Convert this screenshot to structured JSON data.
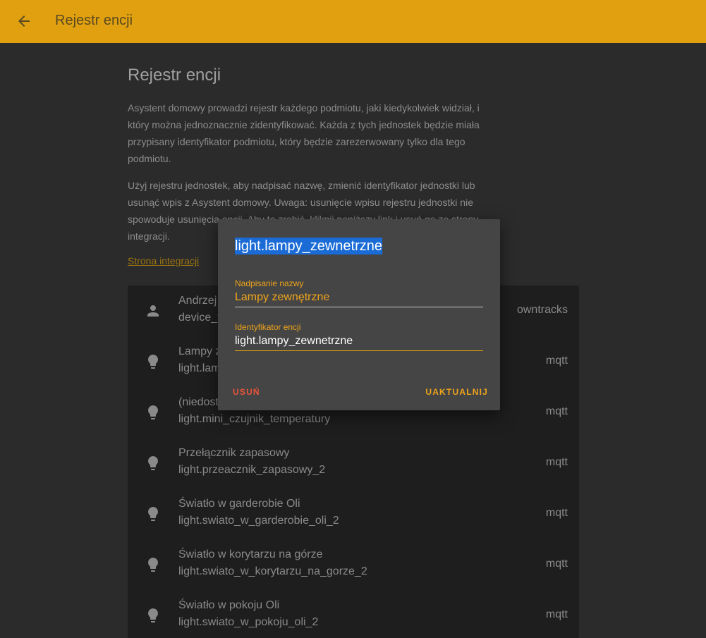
{
  "toolbar": {
    "title": "Rejestr encji",
    "back_icon": "arrow-left-icon",
    "background": "#e0a00f"
  },
  "page": {
    "heading": "Rejestr encji",
    "paragraph1": "Asystent domowy prowadzi rejestr każdego podmiotu, jaki kiedykolwiek widział, i który można jednoznacznie zidentyfikować. Każda z tych jednostek będzie miała przypisany identyfikator podmiotu, który będzie zarezerwowany tylko dla tego podmiotu.",
    "paragraph2": "Użyj rejestru jednostek, aby nadpisać nazwę, zmienić identyfikator jednostki lub usunąć wpis z Asystent domowy. Uwaga: usunięcie wpisu rejestru jednostki nie spowoduje usunięcia encji. Aby to zrobić, kliknij poniższy link i usuń go ze strony integracji.",
    "integrations_link": "Strona integracji"
  },
  "entities": [
    {
      "name": "Andrzej",
      "entity_id": "device_t",
      "platform": "owntracks",
      "icon": "account-icon"
    },
    {
      "name": "Lampy z",
      "entity_id": "light.lam",
      "platform": "mqtt",
      "icon": "lightbulb-icon"
    },
    {
      "name": "(niedost",
      "entity_id": "light.mini_czujnik_temperatury",
      "platform": "mqtt",
      "icon": "lightbulb-icon"
    },
    {
      "name": "Przełącznik zapasowy",
      "entity_id": "light.przeacznik_zapasowy_2",
      "platform": "mqtt",
      "icon": "lightbulb-icon"
    },
    {
      "name": "Światło w garderobie Oli",
      "entity_id": "light.swiato_w_garderobie_oli_2",
      "platform": "mqtt",
      "icon": "lightbulb-icon"
    },
    {
      "name": "Światło w korytarzu na górze",
      "entity_id": "light.swiato_w_korytarzu_na_gorze_2",
      "platform": "mqtt",
      "icon": "lightbulb-icon"
    },
    {
      "name": "Światło w pokoju Oli",
      "entity_id": "light.swiato_w_pokoju_oli_2",
      "platform": "mqtt",
      "icon": "lightbulb-icon"
    }
  ],
  "dialog": {
    "title": "light.lampy_zewnetrzne",
    "name_label": "Nadpisanie nazwy",
    "name_value": "Lampy zewnętrzne",
    "id_label": "Identyfikator encji",
    "id_value": "light.lampy_zewnetrzne",
    "delete_label": "USUŃ",
    "update_label": "UAKTUALNIJ"
  }
}
